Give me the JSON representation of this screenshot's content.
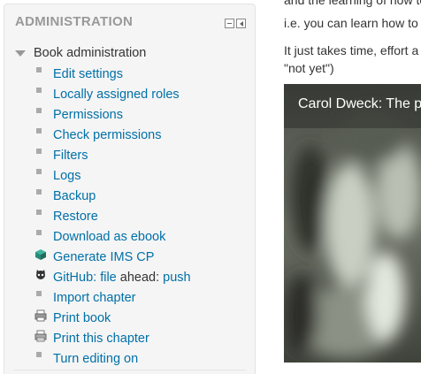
{
  "admin": {
    "title": "ADMINISTRATION",
    "root_label": "Book administration",
    "items": [
      {
        "label": "Edit settings"
      },
      {
        "label": "Locally assigned roles"
      },
      {
        "label": "Permissions"
      },
      {
        "label": "Check permissions"
      },
      {
        "label": "Filters"
      },
      {
        "label": "Logs"
      },
      {
        "label": "Backup"
      },
      {
        "label": "Restore"
      },
      {
        "label": "Download as ebook"
      },
      {
        "label": "Generate IMS CP",
        "icon": "ims-cp-icon"
      },
      {
        "github_label": "GitHub:",
        "file_label": "file",
        "ahead_text": "ahead:",
        "push_label": "push",
        "icon": "github-octocat-icon"
      },
      {
        "label": "Import chapter"
      },
      {
        "label": "Print book",
        "icon": "print-book-icon"
      },
      {
        "label": "Print this chapter",
        "icon": "print-chapter-icon"
      },
      {
        "label": "Turn editing on"
      }
    ]
  },
  "content": {
    "cut_line": "and the learning of how to",
    "para1": "i.e. you can learn how to",
    "para2_line1": "It just takes time, effort a",
    "para2_line2": "\"not yet\")",
    "video_title": "Carol Dweck: The p"
  },
  "colors": {
    "link": "#0070a8",
    "header": "#999999",
    "block_bg": "#f5f5f5"
  }
}
